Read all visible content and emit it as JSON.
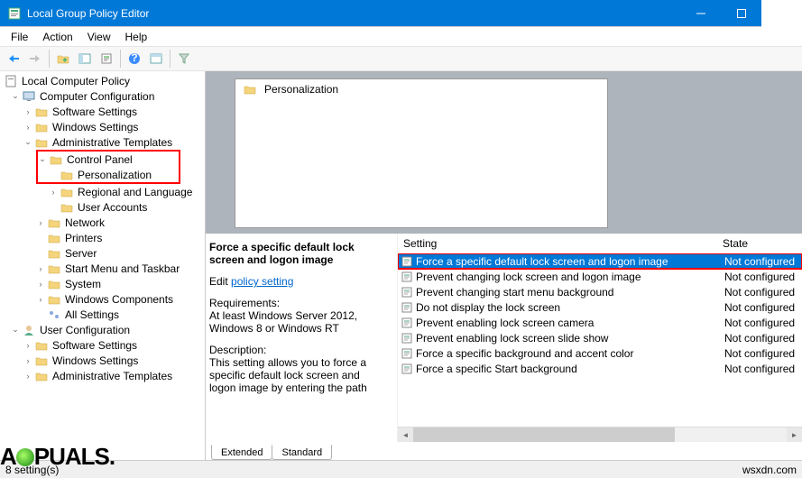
{
  "window": {
    "title": "Local Group Policy Editor"
  },
  "menubar": [
    "File",
    "Action",
    "View",
    "Help"
  ],
  "tree": {
    "root": "Local Computer Policy",
    "computer_cfg": "Computer Configuration",
    "software": "Software Settings",
    "windows": "Windows Settings",
    "admin_tmpl": "Administrative Templates",
    "control_panel": "Control Panel",
    "personalization": "Personalization",
    "regional": "Regional and Language",
    "user_accounts": "User Accounts",
    "network": "Network",
    "printers": "Printers",
    "server": "Server",
    "start_menu": "Start Menu and Taskbar",
    "system": "System",
    "win_components": "Windows Components",
    "all_settings": "All Settings",
    "user_cfg": "User Configuration",
    "u_software": "Software Settings",
    "u_windows": "Windows Settings",
    "u_admin_tmpl": "Administrative Templates"
  },
  "header": {
    "crumb": "Personalization"
  },
  "desc": {
    "title": "Force a specific default lock screen and logon image",
    "edit_prefix": "Edit",
    "edit_link": "policy setting",
    "req_label": "Requirements:",
    "req_text": "At least Windows Server 2012, Windows 8 or Windows RT",
    "desc_label": "Description:",
    "desc_text": "This setting allows you to force a specific default lock screen and logon image by entering the path"
  },
  "columns": {
    "setting": "Setting",
    "state": "State"
  },
  "settings": [
    {
      "label": "Force a specific default lock screen and logon image",
      "state": "Not configured",
      "selected": true,
      "highlighted": true
    },
    {
      "label": "Prevent changing lock screen and logon image",
      "state": "Not configured"
    },
    {
      "label": "Prevent changing start menu background",
      "state": "Not configured"
    },
    {
      "label": "Do not display the lock screen",
      "state": "Not configured"
    },
    {
      "label": "Prevent enabling lock screen camera",
      "state": "Not configured"
    },
    {
      "label": "Prevent enabling lock screen slide show",
      "state": "Not configured"
    },
    {
      "label": "Force a specific background and accent color",
      "state": "Not configured"
    },
    {
      "label": "Force a specific Start background",
      "state": "Not configured"
    }
  ],
  "tabs": {
    "extended": "Extended",
    "standard": "Standard"
  },
  "status": {
    "left": "8 setting(s)",
    "right": "wsxdn.com"
  },
  "watermark": "A  PUALS."
}
